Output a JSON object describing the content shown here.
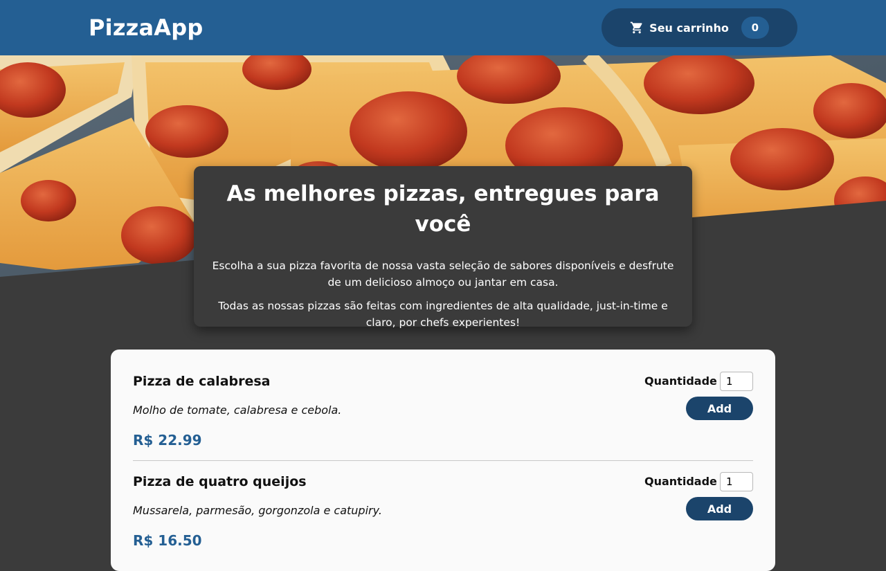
{
  "header": {
    "brand": "PizzaApp",
    "cart": {
      "label": "Seu carrinho",
      "count": "0",
      "icon": "cart-icon"
    },
    "colors": {
      "bar": "#245f93",
      "pill": "#1b446b"
    }
  },
  "intro": {
    "title": "As melhores pizzas, entregues para você",
    "paragraphs": [
      "Escolha a sua pizza favorita de nossa vasta seleção de sabores disponíveis e desfrute de um delicioso almoço ou jantar em casa.",
      "Todas as nossas pizzas são feitas com ingredientes de alta qualidade, just-in-time e claro, por chefs experientes!"
    ]
  },
  "menu": {
    "quantity_label": "Quantidade",
    "add_label": "Add",
    "items": [
      {
        "name": "Pizza de calabresa",
        "description": "Molho de tomate, calabresa e cebola.",
        "price": "R$ 22.99",
        "quantity": "1"
      },
      {
        "name": "Pizza de quatro queijos",
        "description": "Mussarela, parmesão, gorgonzola e catupiry.",
        "price": "R$ 16.50",
        "quantity": "1"
      }
    ]
  }
}
